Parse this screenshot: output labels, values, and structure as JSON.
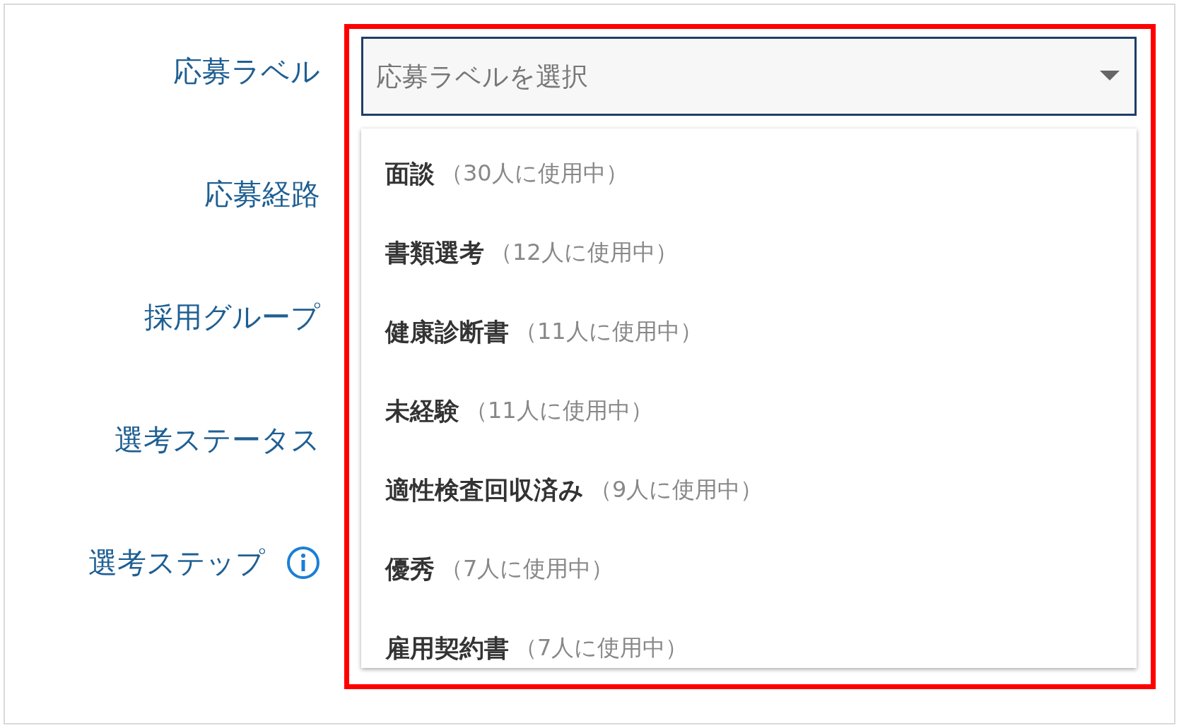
{
  "fields": [
    {
      "label": "応募ラベル",
      "info": false
    },
    {
      "label": "応募経路",
      "info": false
    },
    {
      "label": "採用グループ",
      "info": false
    },
    {
      "label": "選考ステータス",
      "info": false
    },
    {
      "label": "選考ステップ",
      "info": true
    }
  ],
  "select": {
    "placeholder": "応募ラベルを選択",
    "focused": true,
    "expanded": true
  },
  "options": [
    {
      "name": "面談",
      "count": "（30人に使用中）"
    },
    {
      "name": "書類選考",
      "count": "（12人に使用中）"
    },
    {
      "name": "健康診断書",
      "count": "（11人に使用中）"
    },
    {
      "name": "未経験",
      "count": "（11人に使用中）"
    },
    {
      "name": "適性検査回収済み",
      "count": "（9人に使用中）"
    },
    {
      "name": "優秀",
      "count": "（7人に使用中）"
    },
    {
      "name": "雇用契約書",
      "count": "（7人に使用中）"
    }
  ]
}
